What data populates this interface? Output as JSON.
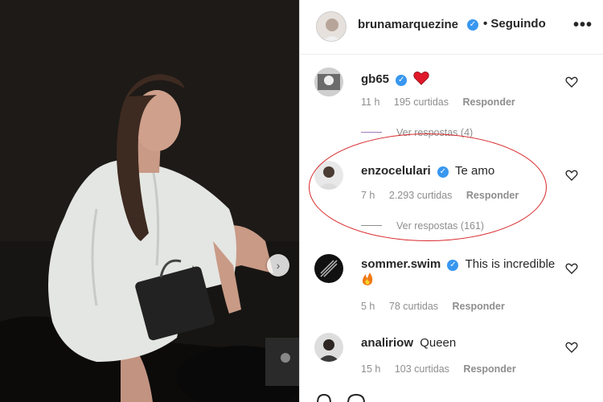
{
  "post": {
    "author": "brunamarquezine",
    "follow_label": "• Seguindo",
    "more_icon": "more-options-icon"
  },
  "comments": [
    {
      "username": "gb65",
      "text": "",
      "emoji": "red-heart",
      "time": "11 h",
      "likes": "195 curtidas",
      "reply": "Responder",
      "view_replies": "Ver respostas (4)"
    },
    {
      "username": "enzocelulari",
      "text": "Te amo",
      "time": "7 h",
      "likes": "2.293 curtidas",
      "reply": "Responder",
      "view_replies": "Ver respostas (161)"
    },
    {
      "username": "sommer.swim",
      "text": "This is incredible",
      "emoji": "fire",
      "time": "5 h",
      "likes": "78 curtidas",
      "reply": "Responder"
    },
    {
      "username": "analiriow",
      "text": "Queen",
      "time": "15 h",
      "likes": "103 curtidas",
      "reply": "Responder"
    }
  ],
  "icons": {
    "next": "chevron-right-icon",
    "like": "heart-outline-icon"
  },
  "colors": {
    "verified": "#3897f0",
    "highlight_ring": "#d9292b",
    "muted_text": "#8e8e8e"
  }
}
